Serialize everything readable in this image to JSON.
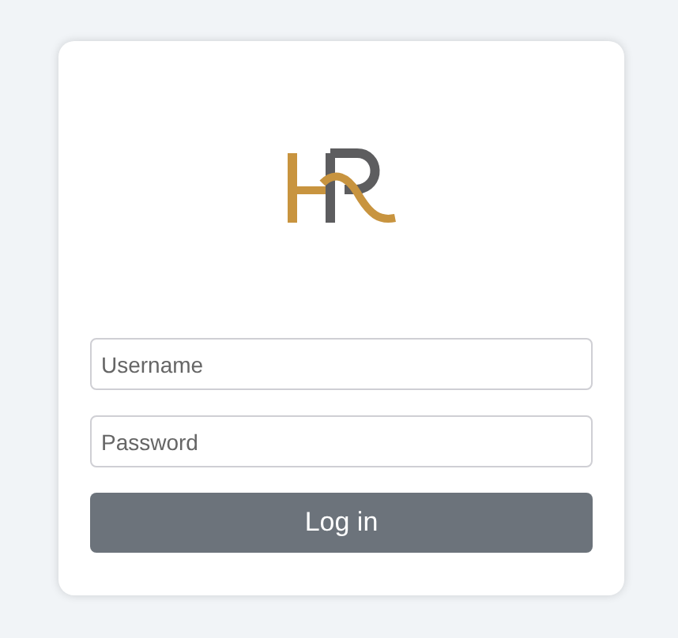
{
  "login": {
    "username": {
      "placeholder": "Username"
    },
    "password": {
      "placeholder": "Password"
    },
    "submit": "Log in"
  }
}
